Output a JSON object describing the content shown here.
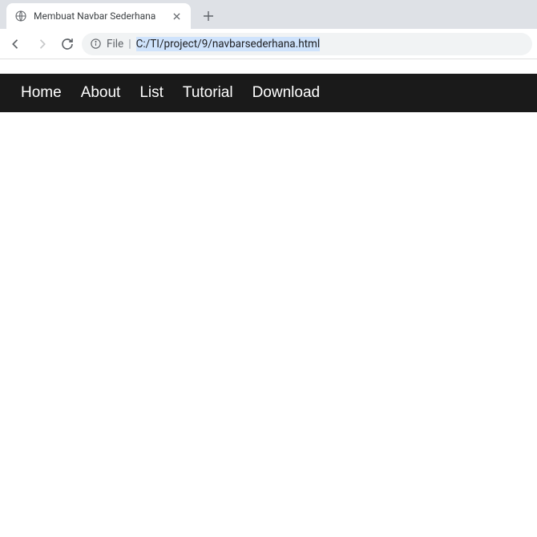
{
  "browser": {
    "tab_title": "Membuat Navbar Sederhana",
    "url_protocol_label": "File",
    "url_path": "C:/TI/project/9/navbarsederhana.html"
  },
  "navbar": {
    "items": [
      {
        "label": "Home"
      },
      {
        "label": "About"
      },
      {
        "label": "List"
      },
      {
        "label": "Tutorial"
      },
      {
        "label": "Download"
      }
    ]
  }
}
